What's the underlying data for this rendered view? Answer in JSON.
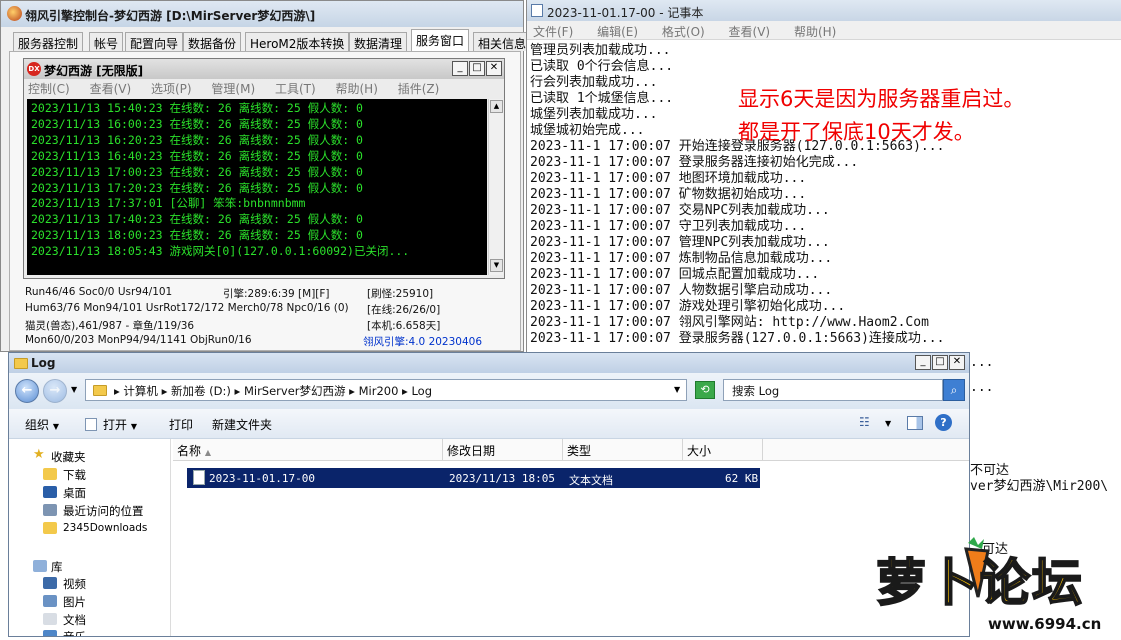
{
  "engine": {
    "title": "翎风引擎控制台-梦幻西游 [D:\\MirServer梦幻西游\\]",
    "tabs": [
      "服务器控制",
      "帐号",
      "配置向导",
      "数据备份",
      "HeroM2版本转换",
      "数据清理",
      "服务窗口",
      "相关信息"
    ],
    "active_tab": "服务窗口",
    "inner": {
      "title": "梦幻西游 [无限版]",
      "icon_label": "DX",
      "menu": [
        "控制(C)",
        "查看(V)",
        "选项(P)",
        "管理(M)",
        "工具(T)",
        "帮助(H)",
        "插件(Z)"
      ],
      "log_lines": [
        "2023/11/13 15:40:23 在线数: 26 离线数: 25 假人数: 0",
        "2023/11/13 16:00:23 在线数: 26 离线数: 25 假人数: 0",
        "2023/11/13 16:20:23 在线数: 26 离线数: 25 假人数: 0",
        "2023/11/13 16:40:23 在线数: 26 离线数: 25 假人数: 0",
        "2023/11/13 17:00:23 在线数: 26 离线数: 25 假人数: 0",
        "2023/11/13 17:20:23 在线数: 26 离线数: 25 假人数: 0",
        "2023/11/13 17:37:01 [公聊] 笨笨:bnbnmnbmm",
        "2023/11/13 17:40:23 在线数: 26 离线数: 25 假人数: 0",
        "2023/11/13 18:00:23 在线数: 26 离线数: 25 假人数: 0",
        "2023/11/13 18:05:43 游戏网关[0](127.0.0.1:60092)已关闭..."
      ]
    },
    "stats": {
      "row1_left": "Run46/46 Soc0/0 Usr94/101",
      "row1_mid": "引擎:289:6:39 [M][F]",
      "row1_right": "[刷怪:25910]",
      "row2_left": "Hum63/76 Mon94/101 UsrRot172/172 Merch0/78 Npc0/16 (0)",
      "row2_right": "[在线:26/26/0]",
      "row3_left": "猫灵(兽态),461/987 - 章鱼/119/36",
      "row3_right": "[本机:6.658天]",
      "row4_left": "Mon60/0/203 MonP94/94/1141 ObjRun0/16",
      "row4_right": "翎风引擎:4.0 20230406"
    }
  },
  "notepad": {
    "title": "2023-11-01.17-00 - 记事本",
    "menu": [
      "文件(F)",
      "编辑(E)",
      "格式(O)",
      "查看(V)",
      "帮助(H)"
    ],
    "lines": [
      "管理员列表加载成功...",
      "已读取 0个行会信息...",
      "行会列表加载成功...",
      "已读取 1个城堡信息...",
      "城堡列表加载成功...",
      "城堡城初始完成...",
      "2023-11-1 17:00:07 开始连接登录服务器(127.0.0.1:5663)...",
      "2023-11-1 17:00:07 登录服务器连接初始化完成...",
      "2023-11-1 17:00:07 地图环境加载成功...",
      "2023-11-1 17:00:07 矿物数据初始成功...",
      "2023-11-1 17:00:07 交易NPC列表加载成功...",
      "2023-11-1 17:00:07 守卫列表加载成功...",
      "2023-11-1 17:00:07 管理NPC列表加载成功...",
      "2023-11-1 17:00:07 炼制物品信息加载成功...",
      "2023-11-1 17:00:07 回城点配置加载成功...",
      "2023-11-1 17:00:07 人物数据引擎启动成功...",
      "2023-11-1 17:00:07 游戏处理引擎初始化成功...",
      "2023-11-1 17:00:07 翎风引擎网站: http://www.Haom2.Com",
      "2023-11-1 17:00:07 登录服务器(127.0.0.1:5663)连接成功..."
    ],
    "annotation_line1": "显示6天是因为服务器重启过。",
    "annotation_line2": "都是开了保底10天才发。"
  },
  "remnants": {
    "dots1": "...",
    "dots2": "...",
    "unreachable": "不可达",
    "path": "ver梦幻西游\\Mir200\\",
    "reach": "可达"
  },
  "explorer": {
    "title": "Log",
    "address": "▸ 计算机 ▸ 新加卷 (D:) ▸ MirServer梦幻西游 ▸ Mir200 ▸ Log",
    "search_placeholder": "搜索 Log",
    "commands": {
      "organize": "组织",
      "open": "打开",
      "print": "打印",
      "new_folder": "新建文件夹"
    },
    "nav": {
      "favorites": "收藏夹",
      "downloads": "下载",
      "desktop": "桌面",
      "recent": "最近访问的位置",
      "downloads2345": "2345Downloads",
      "library": "库",
      "videos": "视频",
      "pictures": "图片",
      "documents": "文档",
      "music": "音乐"
    },
    "columns": {
      "name": "名称",
      "date": "修改日期",
      "type": "类型",
      "size": "大小"
    },
    "file": {
      "name": "2023-11-01.17-00",
      "date": "2023/11/13 18:05",
      "type": "文本文档",
      "size": "62 KB"
    }
  },
  "logo": {
    "text": "萝卜论坛",
    "url": "www.6994.cn"
  },
  "colors": {
    "console_bg": "#000000",
    "console_text": "#2be02b",
    "annotation": "#f00000",
    "version_link": "#0033cc",
    "selected_row": "#0a246a"
  }
}
